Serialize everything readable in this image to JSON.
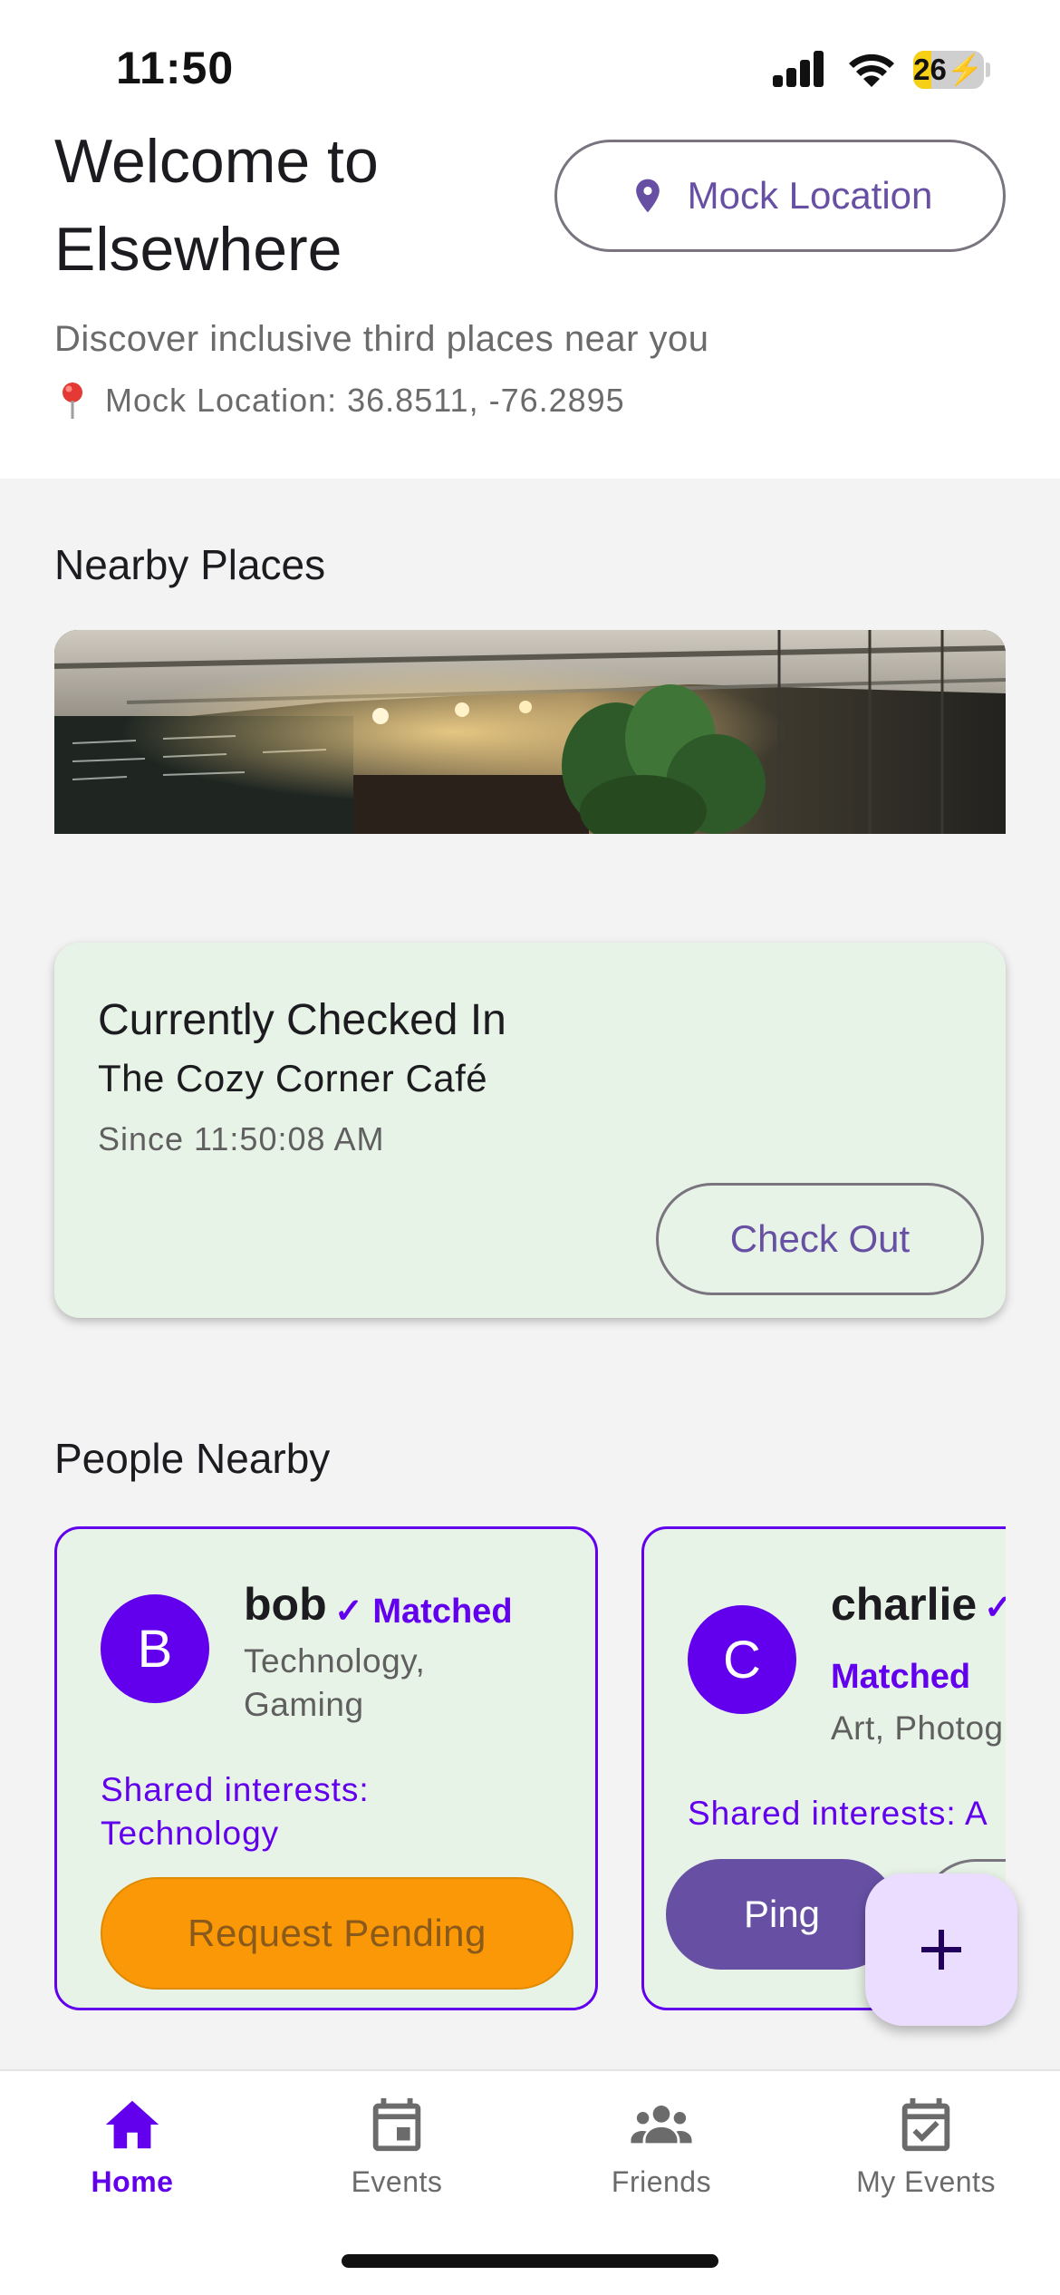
{
  "status_bar": {
    "time": "11:50",
    "battery": "26",
    "battery_level": 0.26
  },
  "header": {
    "title": "Welcome to Elsewhere",
    "mock_location_button": "Mock Location",
    "subtitle": "Discover inclusive third places near you",
    "coordinates": "Mock Location: 36.8511, -76.2895",
    "pin_icon": "location-pin-icon",
    "pushpin_icon": "pushpin-icon"
  },
  "nearby_places": {
    "title": "Nearby Places"
  },
  "checked_in": {
    "title": "Currently Checked In",
    "place": "The Cozy Corner Café",
    "since": "Since 11:50:08 AM",
    "checkout_label": "Check Out"
  },
  "people_nearby": {
    "title": "People Nearby",
    "people": [
      {
        "initial": "B",
        "name": "bob",
        "matched": "✓ Matched",
        "interests": "Technology, Gaming",
        "shared": "Shared interests: Technology",
        "action_label": "Request Pending"
      },
      {
        "initial": "C",
        "name": "charlie",
        "check": "✓",
        "matched": "Matched",
        "interests": "Art, Photog",
        "shared": "Shared interests: A",
        "action_label": "Ping"
      }
    ]
  },
  "fab": {
    "icon": "plus-icon"
  },
  "bottom_nav": {
    "items": [
      {
        "label": "Home",
        "icon": "home-icon",
        "active": true
      },
      {
        "label": "Events",
        "icon": "calendar-icon",
        "active": false
      },
      {
        "label": "Friends",
        "icon": "group-icon",
        "active": false
      },
      {
        "label": "My Events",
        "icon": "calendar-check-icon",
        "active": false
      }
    ]
  },
  "colors": {
    "primary": "#6750a4",
    "accent": "#6200ee",
    "card_bg": "#e8f3e7",
    "pending": "#fb9808",
    "fab_bg": "#eaddff"
  }
}
